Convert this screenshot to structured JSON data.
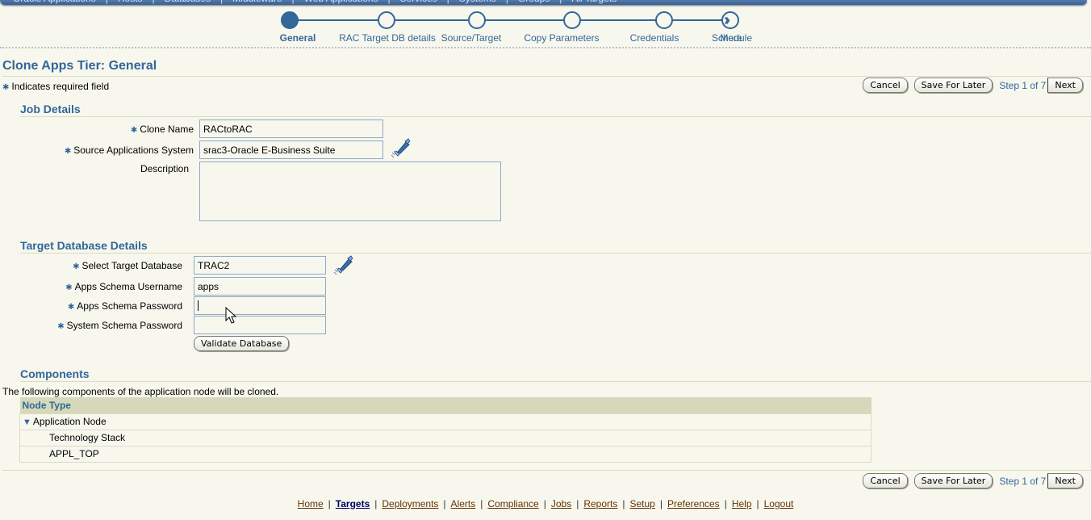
{
  "global_tabs": [
    "Oracle Applications",
    "Hosts",
    "Databases",
    "Middleware",
    "Web Applications",
    "Services",
    "Systems",
    "Groups",
    "All Targets"
  ],
  "train": {
    "steps": [
      {
        "label": "General",
        "current": true
      },
      {
        "label": "RAC Target DB details",
        "current": false
      },
      {
        "label": "Source/Target",
        "current": false
      },
      {
        "label": "Copy Parameters",
        "current": false
      },
      {
        "label": "Credentials",
        "current": false
      },
      {
        "label": "Schedule",
        "current": false
      }
    ],
    "more_label": "More"
  },
  "page": {
    "title": "Clone Apps Tier: General",
    "required_note": "Indicates required field",
    "required_star": "✱"
  },
  "nav": {
    "cancel": "Cancel",
    "save_for_later": "Save For Later",
    "step_text": "Step 1 of 7",
    "next": "Next"
  },
  "job_details": {
    "heading": "Job Details",
    "clone_name_label": "Clone Name",
    "clone_name_value": "RACtoRAC",
    "source_system_label": "Source Applications System",
    "source_system_value": "srac3-Oracle E-Business Suite",
    "description_label": "Description",
    "description_value": ""
  },
  "target_db": {
    "heading": "Target Database Details",
    "select_db_label": "Select Target Database",
    "select_db_value": "TRAC2",
    "apps_user_label": "Apps Schema Username",
    "apps_user_value": "apps",
    "apps_pwd_label": "Apps Schema Password",
    "apps_pwd_value": "",
    "system_pwd_label": "System Schema Password",
    "system_pwd_value": "",
    "validate_button": "Validate Database"
  },
  "components": {
    "heading": "Components",
    "description": "The following components of the application node will be cloned.",
    "column_header": "Node Type",
    "rows": [
      {
        "label": "Application Node",
        "expanded": true,
        "level": 0
      },
      {
        "label": "Technology Stack",
        "level": 1
      },
      {
        "label": "APPL_TOP",
        "level": 1
      }
    ]
  },
  "footer_links": [
    {
      "label": "Home",
      "active": false
    },
    {
      "label": "Targets",
      "active": true
    },
    {
      "label": "Deployments",
      "active": false
    },
    {
      "label": "Alerts",
      "active": false
    },
    {
      "label": "Compliance",
      "active": false
    },
    {
      "label": "Jobs",
      "active": false
    },
    {
      "label": "Reports",
      "active": false
    },
    {
      "label": "Setup",
      "active": false
    },
    {
      "label": "Preferences",
      "active": false
    },
    {
      "label": "Help",
      "active": false
    },
    {
      "label": "Logout",
      "active": false
    }
  ]
}
